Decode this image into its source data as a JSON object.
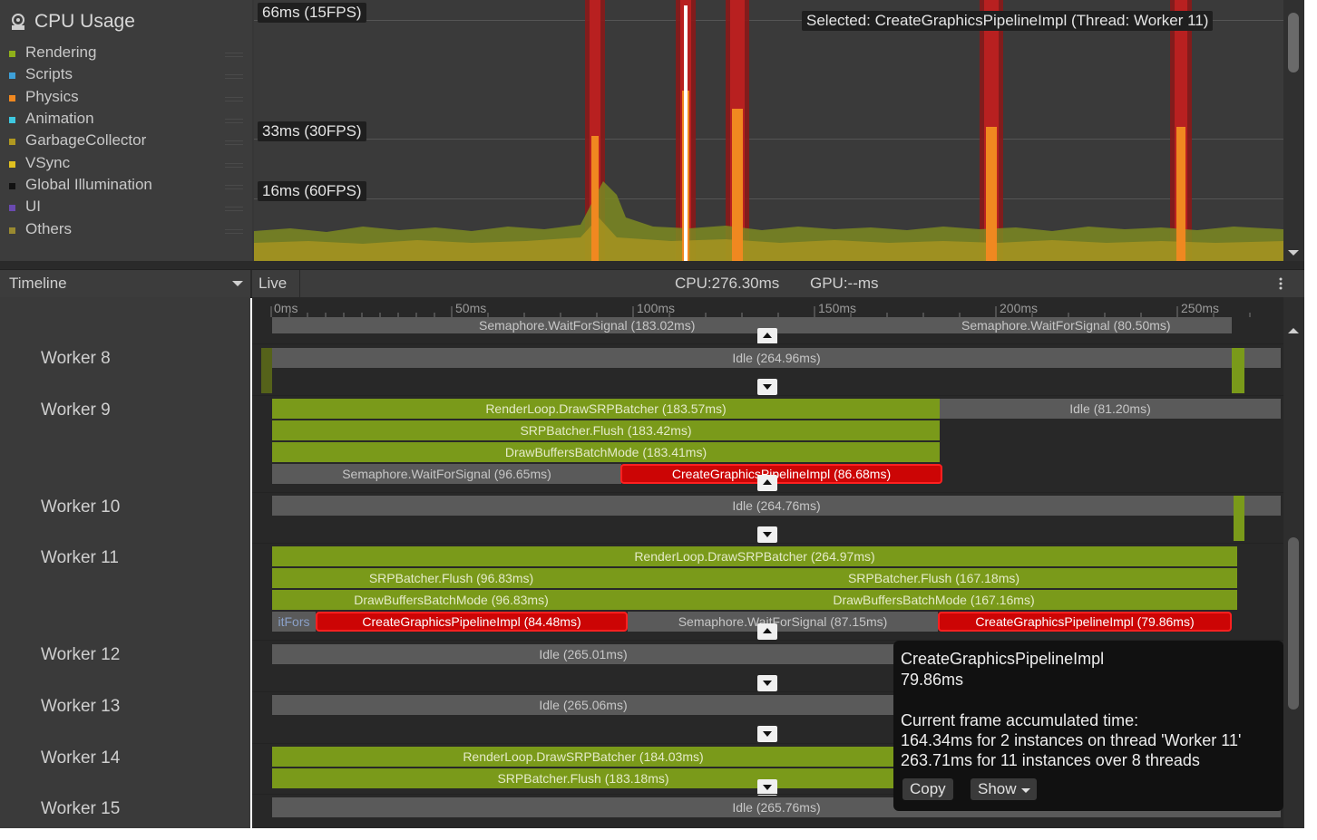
{
  "legend": {
    "title": "CPU Usage",
    "items": [
      {
        "label": "Rendering",
        "color": "#8fb01a"
      },
      {
        "label": "Scripts",
        "color": "#3ea0d8"
      },
      {
        "label": "Physics",
        "color": "#f08820"
      },
      {
        "label": "Animation",
        "color": "#3ec8e0"
      },
      {
        "label": "GarbageCollector",
        "color": "#b09820"
      },
      {
        "label": "VSync",
        "color": "#e0c020"
      },
      {
        "label": "Global Illumination",
        "color": "#111111"
      },
      {
        "label": "UI",
        "color": "#6a4ab0"
      },
      {
        "label": "Others",
        "color": "#9a8a30"
      }
    ]
  },
  "chart": {
    "fps_labels": [
      "66ms (15FPS)",
      "33ms (30FPS)",
      "16ms (60FPS)"
    ],
    "selected_label": "Selected: CreateGraphicsPipelineImpl (Thread: Worker 11)"
  },
  "toolbar": {
    "view_mode": "Timeline",
    "live": "Live",
    "cpu": "CPU:276.30ms",
    "gpu": "GPU:--ms"
  },
  "ruler": [
    "0ms",
    "50ms",
    "100ms",
    "150ms",
    "200ms",
    "250ms"
  ],
  "top_row": {
    "left": "Semaphore.WaitForSignal (183.02ms)",
    "right": "Semaphore.WaitForSignal (80.50ms)"
  },
  "workers": [
    {
      "name": "Worker 8",
      "bars": [
        "Idle (264.96ms)"
      ]
    },
    {
      "name": "Worker 9",
      "bars": [
        "RenderLoop.DrawSRPBatcher (183.57ms)",
        "Idle (81.20ms)",
        "SRPBatcher.Flush (183.42ms)",
        "DrawBuffersBatchMode (183.41ms)",
        "Semaphore.WaitForSignal (96.65ms)",
        "CreateGraphicsPipelineImpl (86.68ms)"
      ]
    },
    {
      "name": "Worker 10",
      "bars": [
        "Idle (264.76ms)"
      ]
    },
    {
      "name": "Worker 11",
      "bars": [
        "RenderLoop.DrawSRPBatcher (264.97ms)",
        "SRPBatcher.Flush (96.83ms)",
        "SRPBatcher.Flush (167.18ms)",
        "DrawBuffersBatchMode (96.83ms)",
        "DrawBuffersBatchMode (167.16ms)",
        "itFors",
        "CreateGraphicsPipelineImpl (84.48ms)",
        "Semaphore.WaitForSignal (87.15ms)",
        "CreateGraphicsPipelineImpl (79.86ms)"
      ]
    },
    {
      "name": "Worker 12",
      "bars": [
        "Idle (265.01ms)"
      ]
    },
    {
      "name": "Worker 13",
      "bars": [
        "Idle (265.06ms)"
      ]
    },
    {
      "name": "Worker 14",
      "bars": [
        "RenderLoop.DrawSRPBatcher (184.03ms)",
        "SRPBatcher.Flush (183.18ms)"
      ]
    },
    {
      "name": "Worker 15",
      "bars": [
        "Idle (265.76ms)"
      ]
    }
  ],
  "tooltip": {
    "name": "CreateGraphicsPipelineImpl",
    "time": "79.86ms",
    "heading": "Current frame accumulated time:",
    "line1": "164.34ms for 2 instances on thread 'Worker 11'",
    "line2": "263.71ms for 11 instances over 8 threads",
    "copy": "Copy",
    "show": "Show"
  }
}
